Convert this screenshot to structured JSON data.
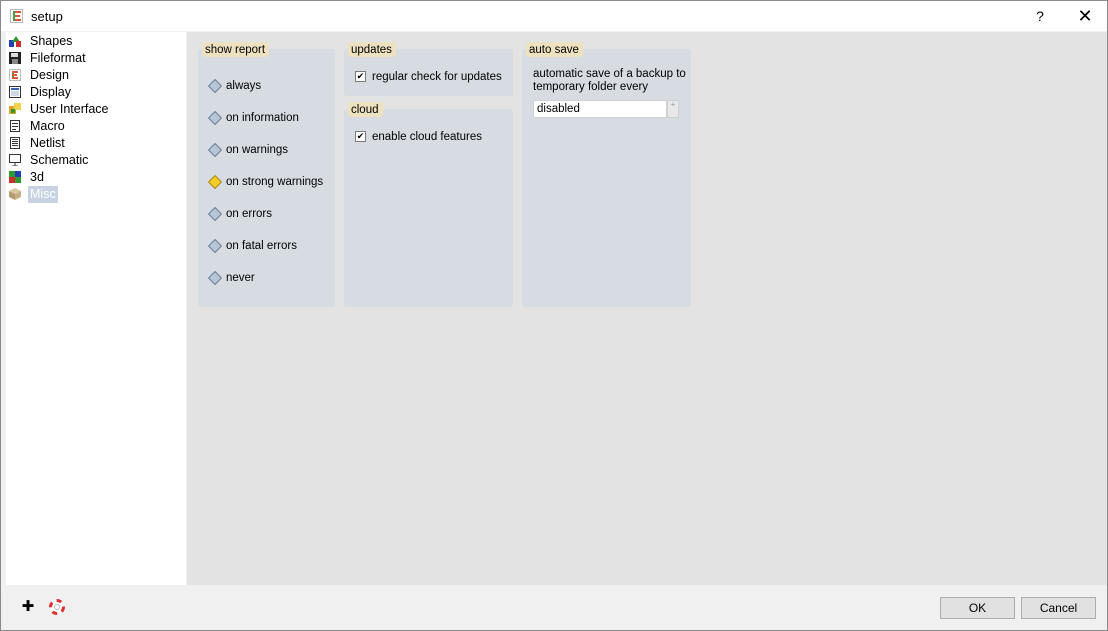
{
  "window": {
    "title": "setup",
    "help_glyph": "?",
    "close_glyph": "✕"
  },
  "sidebar": {
    "items": [
      {
        "label": "Shapes",
        "icon": "shapes-icon"
      },
      {
        "label": "Fileformat",
        "icon": "floppy-disk-icon"
      },
      {
        "label": "Design",
        "icon": "design-e-icon"
      },
      {
        "label": "Display",
        "icon": "display-icon"
      },
      {
        "label": "User Interface",
        "icon": "user-interface-icon"
      },
      {
        "label": "Macro",
        "icon": "macro-icon"
      },
      {
        "label": "Netlist",
        "icon": "netlist-icon"
      },
      {
        "label": "Schematic",
        "icon": "schematic-icon"
      },
      {
        "label": "3d",
        "icon": "3d-cube-icon"
      },
      {
        "label": "Misc",
        "icon": "misc-box-icon",
        "selected": true
      }
    ]
  },
  "show_report": {
    "title": "show report",
    "options": [
      {
        "label": "always",
        "selected": false
      },
      {
        "label": "on information",
        "selected": false
      },
      {
        "label": "on warnings",
        "selected": false
      },
      {
        "label": "on strong warnings",
        "selected": true
      },
      {
        "label": "on errors",
        "selected": false
      },
      {
        "label": "on fatal errors",
        "selected": false
      },
      {
        "label": "never",
        "selected": false
      }
    ]
  },
  "updates": {
    "title": "updates",
    "regular_check": {
      "label": "regular check for updates",
      "checked": true
    }
  },
  "cloud": {
    "title": "cloud",
    "enable_cloud": {
      "label": "enable cloud features",
      "checked": true
    }
  },
  "auto_save": {
    "title": "auto save",
    "description": "automatic save of a backup  to temporary folder every",
    "value": "disabled",
    "spin_glyph": "+"
  },
  "bottom": {
    "add_glyph": "✚",
    "help_glyph": "✱"
  },
  "buttons": {
    "ok": "OK",
    "cancel": "Cancel"
  },
  "colors": {
    "selected_radio": "#f4cc27",
    "group_bg": "#d7dbe2",
    "group_title_bg": "#ede1bf",
    "selection": "#c7d3e3"
  }
}
